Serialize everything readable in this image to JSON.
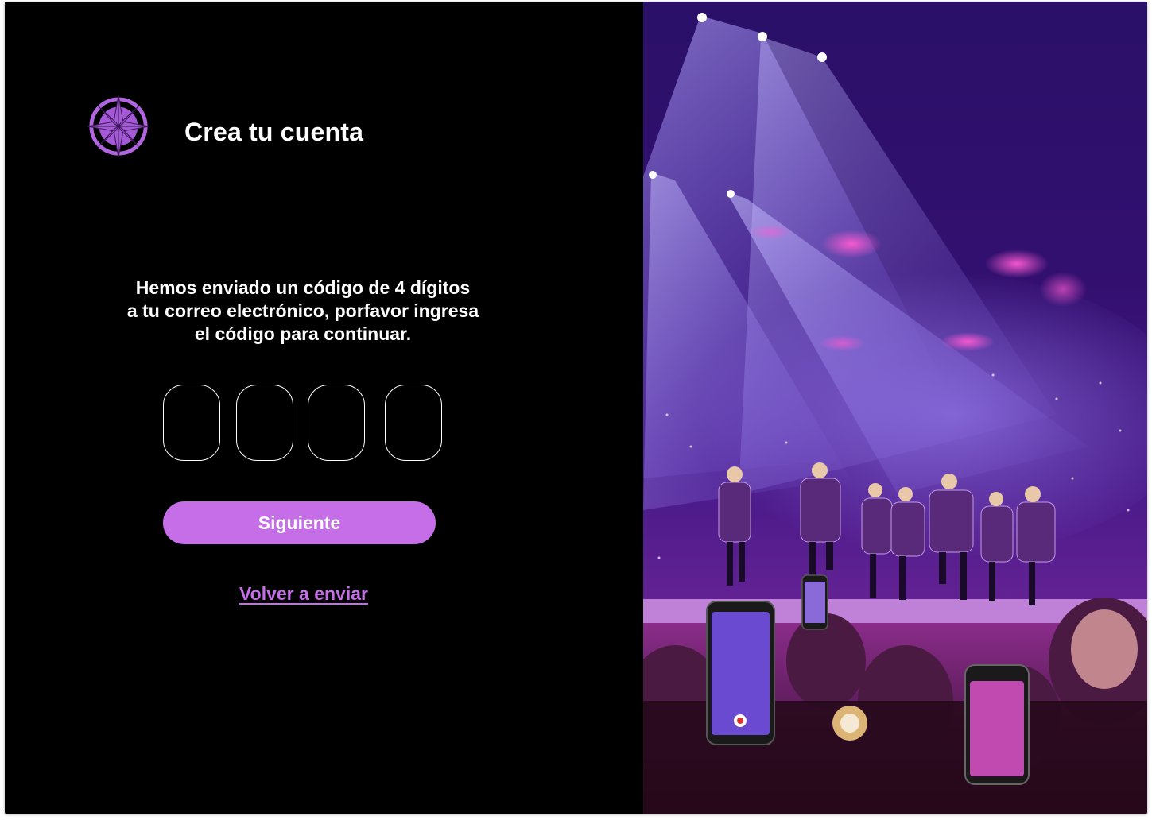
{
  "header": {
    "logo_icon": "compass-rose-icon",
    "title": "Crea tu cuenta"
  },
  "verification": {
    "message_lines": [
      "Hemos enviado un código de 4 dígitos",
      "a tu correo electrónico, porfavor ingresa",
      "el código para continuar."
    ],
    "code_digits": [
      "",
      "",
      "",
      ""
    ]
  },
  "actions": {
    "next_label": "Siguiente",
    "resend_label": "Volver a enviar"
  },
  "hero_image": {
    "subject": "concert-photo"
  },
  "colors": {
    "background": "#000000",
    "accent": "#c56ee7",
    "text": "#ffffff",
    "logo": "#a45ad6"
  }
}
